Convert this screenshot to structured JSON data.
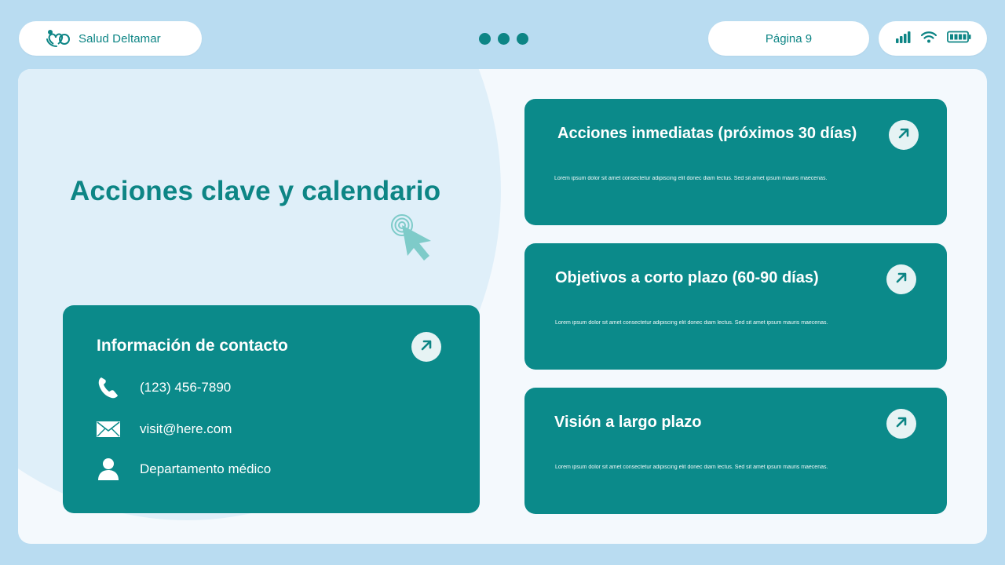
{
  "header": {
    "brand_name": "Salud Deltamar",
    "page_label": "Página 9"
  },
  "main": {
    "title": "Acciones clave y calendario"
  },
  "contact": {
    "title": "Información de contacto",
    "phone": "(123) 456-7890",
    "email": "visit@here.com",
    "department": "Departamento médico"
  },
  "cards": [
    {
      "title": "Acciones inmediatas (próximos 30 días)",
      "body": "Lorem ipsum dolor sit amet consectetur adipiscing elit donec diam lectus. Sed sit amet ipsum mauris maecenas."
    },
    {
      "title": "Objetivos a corto plazo (60-90 días)",
      "body": "Lorem ipsum dolor sit amet consectetur adipiscing elit donec diam lectus. Sed sit amet ipsum mauris maecenas."
    },
    {
      "title": "Visión a largo plazo",
      "body": "Lorem ipsum dolor sit amet consectetur adipiscing elit donec diam lectus. Sed sit amet ipsum mauris maecenas."
    }
  ],
  "icons": {
    "brand": "heart-hands-icon",
    "signal": "signal-icon",
    "wifi": "wifi-icon",
    "battery": "battery-icon",
    "phone": "phone-icon",
    "email": "envelope-icon",
    "user": "user-icon",
    "arrow": "arrow-up-right-icon",
    "cursor": "cursor-click-icon"
  },
  "colors": {
    "background": "#b9dcf1",
    "accent": "#0d8585",
    "card": "#0b8a8a",
    "panel": "#f4f9fd"
  }
}
